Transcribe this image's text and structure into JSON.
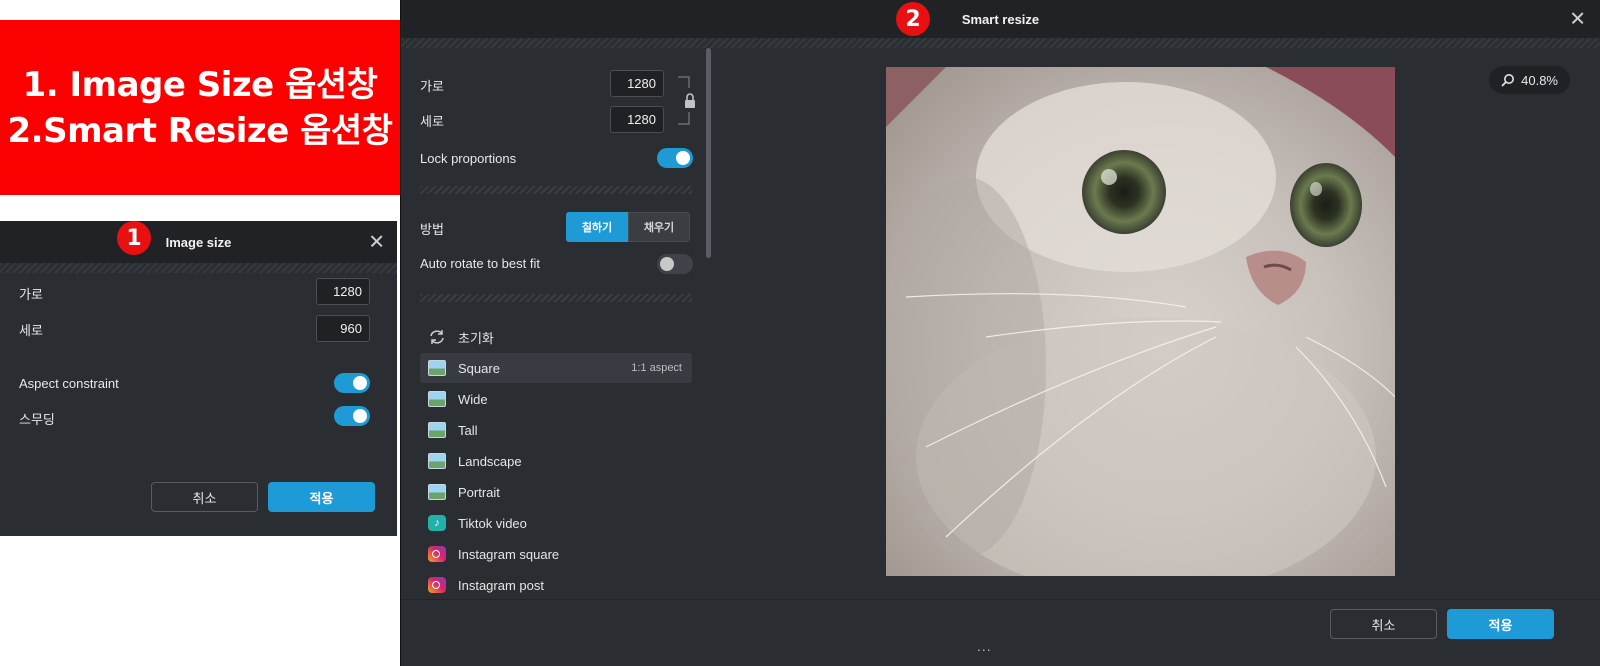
{
  "banner": {
    "line1": "1. Image Size 옵션창",
    "line2": "2.Smart Resize 옵션창"
  },
  "image_size_dialog": {
    "badge": "1",
    "title": "Image size",
    "close_icon": "close-icon",
    "width_label": "가로",
    "width_value": "1280",
    "height_label": "세로",
    "height_value": "960",
    "aspect_label": "Aspect constraint",
    "aspect_on": true,
    "smoothing_label": "스무딩",
    "smoothing_on": true,
    "cancel_label": "취소",
    "apply_label": "적용"
  },
  "smart_resize_dialog": {
    "badge": "2",
    "title": "Smart resize",
    "close_icon": "close-icon",
    "width_label": "가로",
    "width_value": "1280",
    "height_label": "세로",
    "height_value": "1280",
    "lock_icon": "lock-icon",
    "lock_label": "Lock proportions",
    "lock_on": true,
    "method_label": "방법",
    "method_options": [
      "칠하기",
      "채우기"
    ],
    "method_selected": "칠하기",
    "auto_rotate_label": "Auto rotate to best fit",
    "auto_rotate_on": false,
    "presets": [
      {
        "label": "초기화",
        "icon": "reset-icon"
      },
      {
        "label": "Square",
        "icon": "image-thumbnail-icon",
        "meta": "1:1 aspect",
        "selected": true
      },
      {
        "label": "Wide",
        "icon": "image-thumbnail-icon"
      },
      {
        "label": "Tall",
        "icon": "image-thumbnail-icon"
      },
      {
        "label": "Landscape",
        "icon": "image-thumbnail-icon"
      },
      {
        "label": "Portrait",
        "icon": "image-thumbnail-icon"
      },
      {
        "label": "Tiktok video",
        "icon": "tiktok-icon"
      },
      {
        "label": "Instagram square",
        "icon": "instagram-icon"
      },
      {
        "label": "Instagram post",
        "icon": "instagram-icon"
      }
    ],
    "zoom_icon": "magnifier-icon",
    "zoom_value": "40.8%",
    "cancel_label": "취소",
    "apply_label": "적용",
    "more_indicator": "..."
  },
  "colors": {
    "accent": "#1e9bd6",
    "banner_red": "#fb0000",
    "badge_red": "#e81010",
    "dialog_bg": "#2a2d31",
    "titlebar_bg": "#202226"
  }
}
